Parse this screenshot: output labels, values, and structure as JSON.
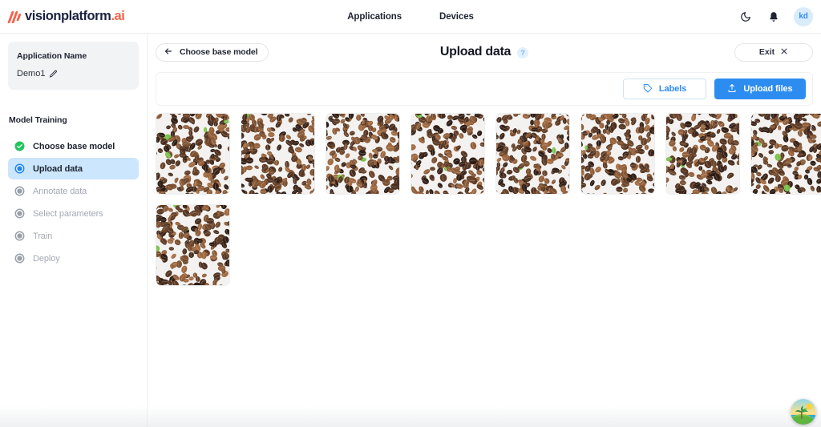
{
  "brand": {
    "name": "visionplatform",
    "suffix": ".ai",
    "logo_icon": "slashes-logo-icon"
  },
  "topnav": {
    "items": [
      {
        "label": "Applications"
      },
      {
        "label": "Devices"
      }
    ],
    "dark_mode_icon": "moon-icon",
    "notifications_icon": "bell-icon",
    "avatar_initials": "kd"
  },
  "sidebar": {
    "app_card": {
      "title": "Application Name",
      "value": "Demo1",
      "edit_icon": "pencil-icon"
    },
    "section_title": "Model Training",
    "steps": [
      {
        "label": "Choose base model",
        "state": "done",
        "icon": "check-circle-icon"
      },
      {
        "label": "Upload data",
        "state": "active",
        "icon": "radio-selected-icon"
      },
      {
        "label": "Annotate data",
        "state": "disabled",
        "icon": "radio-disabled-icon"
      },
      {
        "label": "Select parameters",
        "state": "disabled",
        "icon": "radio-disabled-icon"
      },
      {
        "label": "Train",
        "state": "disabled",
        "icon": "radio-disabled-icon"
      },
      {
        "label": "Deploy",
        "state": "disabled",
        "icon": "radio-disabled-icon"
      }
    ]
  },
  "main": {
    "back_button": {
      "label": "Choose base model",
      "icon": "arrow-left-icon"
    },
    "page_title": "Upload data",
    "help_badge": "?",
    "exit_button": {
      "label": "Exit",
      "icon": "close-icon"
    },
    "toolbar": {
      "labels_button": {
        "label": "Labels",
        "icon": "tag-icon"
      },
      "upload_button": {
        "label": "Upload files",
        "icon": "upload-icon"
      }
    },
    "thumbnails": [
      {
        "alt": "coffee-beans-sample-1",
        "seed": 11
      },
      {
        "alt": "coffee-beans-sample-2",
        "seed": 27
      },
      {
        "alt": "coffee-beans-sample-3",
        "seed": 43
      },
      {
        "alt": "coffee-beans-sample-4",
        "seed": 58
      },
      {
        "alt": "coffee-beans-sample-5",
        "seed": 71
      },
      {
        "alt": "coffee-beans-sample-6",
        "seed": 89
      },
      {
        "alt": "coffee-beans-sample-7",
        "seed": 103
      },
      {
        "alt": "coffee-beans-sample-8",
        "seed": 117
      },
      {
        "alt": "coffee-beans-sample-9",
        "seed": 131
      }
    ]
  },
  "chat_widget": {
    "icon": "island-scene-icon"
  },
  "colors": {
    "accent_blue": "#2d8cf0",
    "active_step_bg": "#cbe6fd",
    "brand_coral": "#f4624a",
    "success_green": "#22c55e",
    "sidebar_card_bg": "#f2f3f5"
  }
}
